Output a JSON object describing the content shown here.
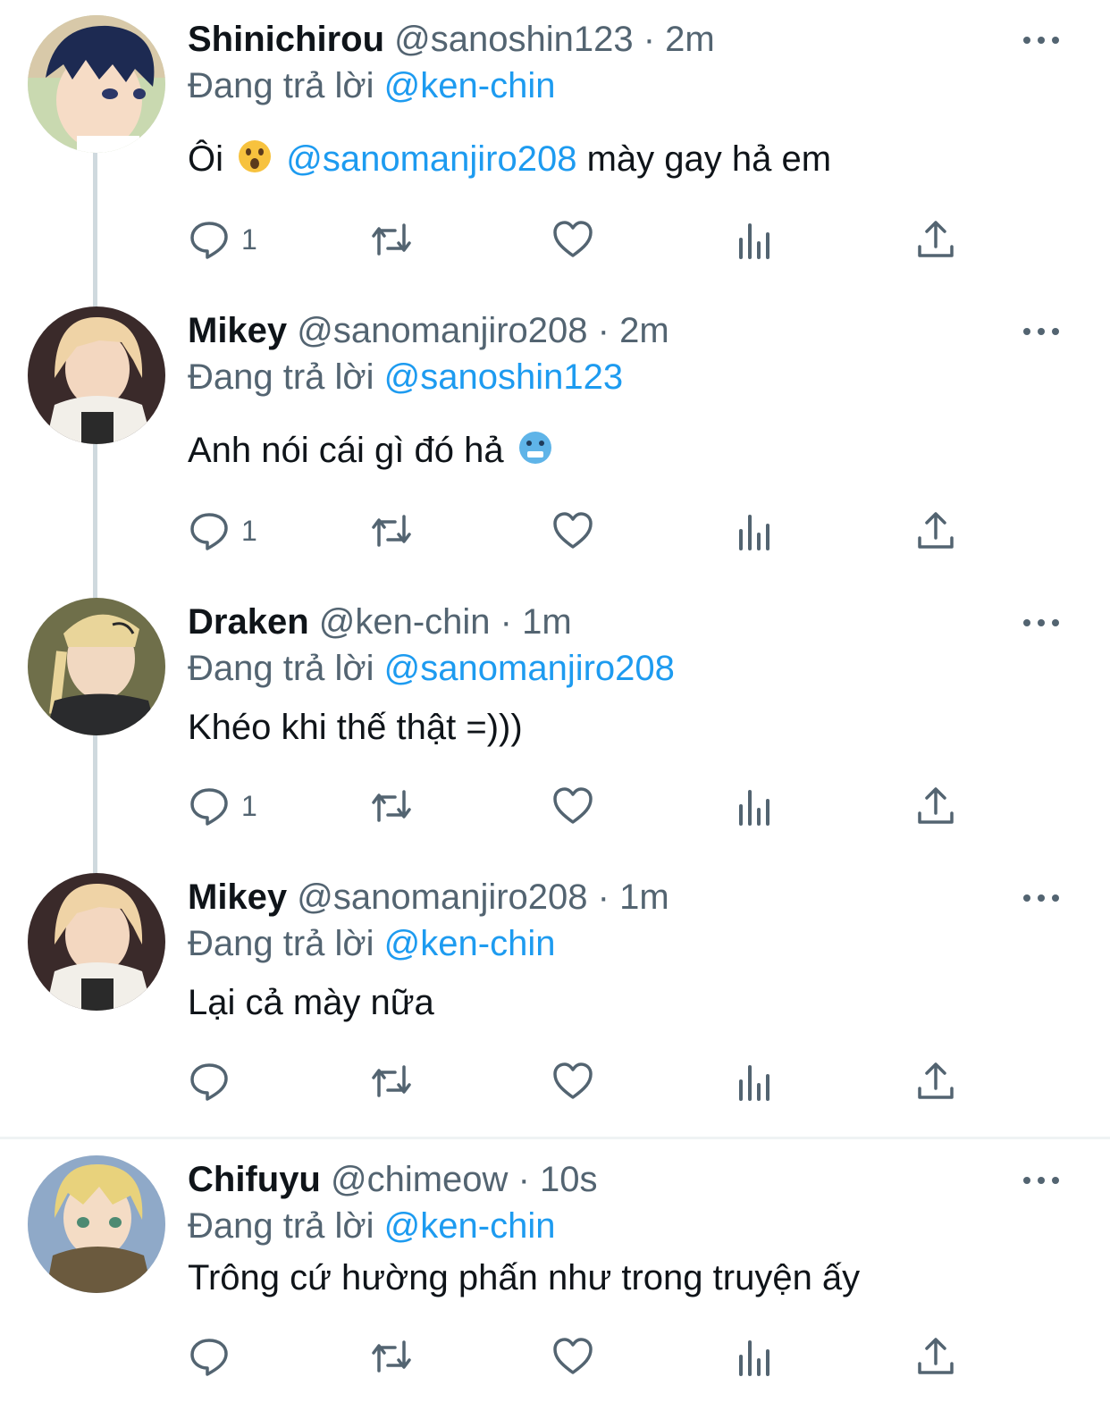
{
  "colors": {
    "accent": "#1d9bf0",
    "muted": "#536471",
    "text": "#0f1419",
    "line": "#cfd9de"
  },
  "icons": {
    "more": "more-horizontal-icon",
    "reply": "reply-icon",
    "retweet": "retweet-icon",
    "like": "heart-icon",
    "views": "views-icon",
    "share": "share-icon"
  },
  "tweets": [
    {
      "name": "Shinichirou",
      "handle": "@sanoshin123",
      "sep": "·",
      "time": "2m",
      "reply_prefix": "Đang trả lời",
      "reply_to": "@ken-chin",
      "text_pre": "Ôi",
      "emoji": "astonished-face-emoji",
      "mention": "@sanomanjiro208",
      "text_post": "mày gay hả em",
      "reply_count": "1"
    },
    {
      "name": "Mikey",
      "handle": "@sanomanjiro208",
      "sep": "·",
      "time": "2m",
      "reply_prefix": "Đang trả lời",
      "reply_to": "@sanoshin123",
      "text": "Anh nói cái gì đó hả",
      "emoji": "cold-face-emoji",
      "reply_count": "1"
    },
    {
      "name": "Draken",
      "handle": "@ken-chin",
      "sep": "·",
      "time": "1m",
      "reply_prefix": "Đang trả lời",
      "reply_to": "@sanomanjiro208",
      "text": "Khéo khi thế thật =)))",
      "reply_count": "1"
    },
    {
      "name": "Mikey",
      "handle": "@sanomanjiro208",
      "sep": "·",
      "time": "1m",
      "reply_prefix": "Đang trả lời",
      "reply_to": "@ken-chin",
      "text": "Lại cả mày nữa",
      "reply_count": ""
    },
    {
      "name": "Chifuyu",
      "handle": "@chimeow",
      "sep": "·",
      "time": "10s",
      "reply_prefix": "Đang trả lời",
      "reply_to": "@ken-chin",
      "text": "Trông cứ hường phấn như trong truyện ấy",
      "reply_count": ""
    }
  ]
}
